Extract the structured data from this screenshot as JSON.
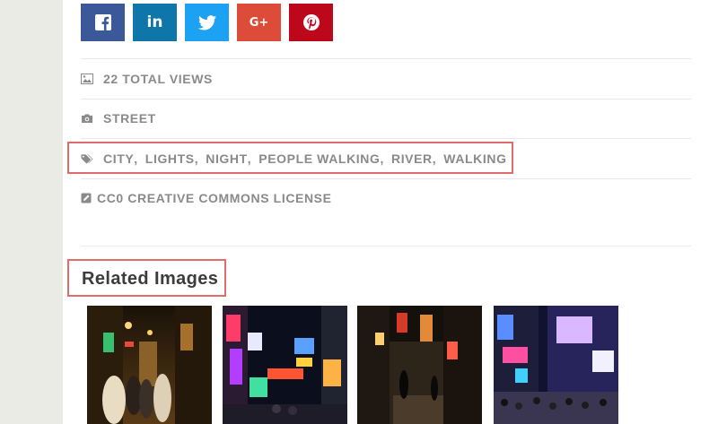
{
  "social": {
    "buttons": [
      {
        "name": "facebook",
        "glyph": "f",
        "color": "#3b5998"
      },
      {
        "name": "linkedin",
        "glyph": "in",
        "color": "#0e76a8"
      },
      {
        "name": "twitter",
        "glyph": "🐦",
        "color": "#1da1f2"
      },
      {
        "name": "google-plus",
        "glyph": "G+",
        "color": "#dd4b39"
      },
      {
        "name": "pinterest",
        "glyph": "P",
        "color": "#bd081c"
      }
    ]
  },
  "meta": {
    "views": "22 TOTAL VIEWS",
    "category": "STREET",
    "tags": [
      "CITY",
      "LIGHTS",
      "NIGHT",
      "PEOPLE WALKING",
      "RIVER",
      "WALKING"
    ],
    "license": "CC0 CREATIVE COMMONS LICENSE"
  },
  "related": {
    "title": "Related Images"
  }
}
